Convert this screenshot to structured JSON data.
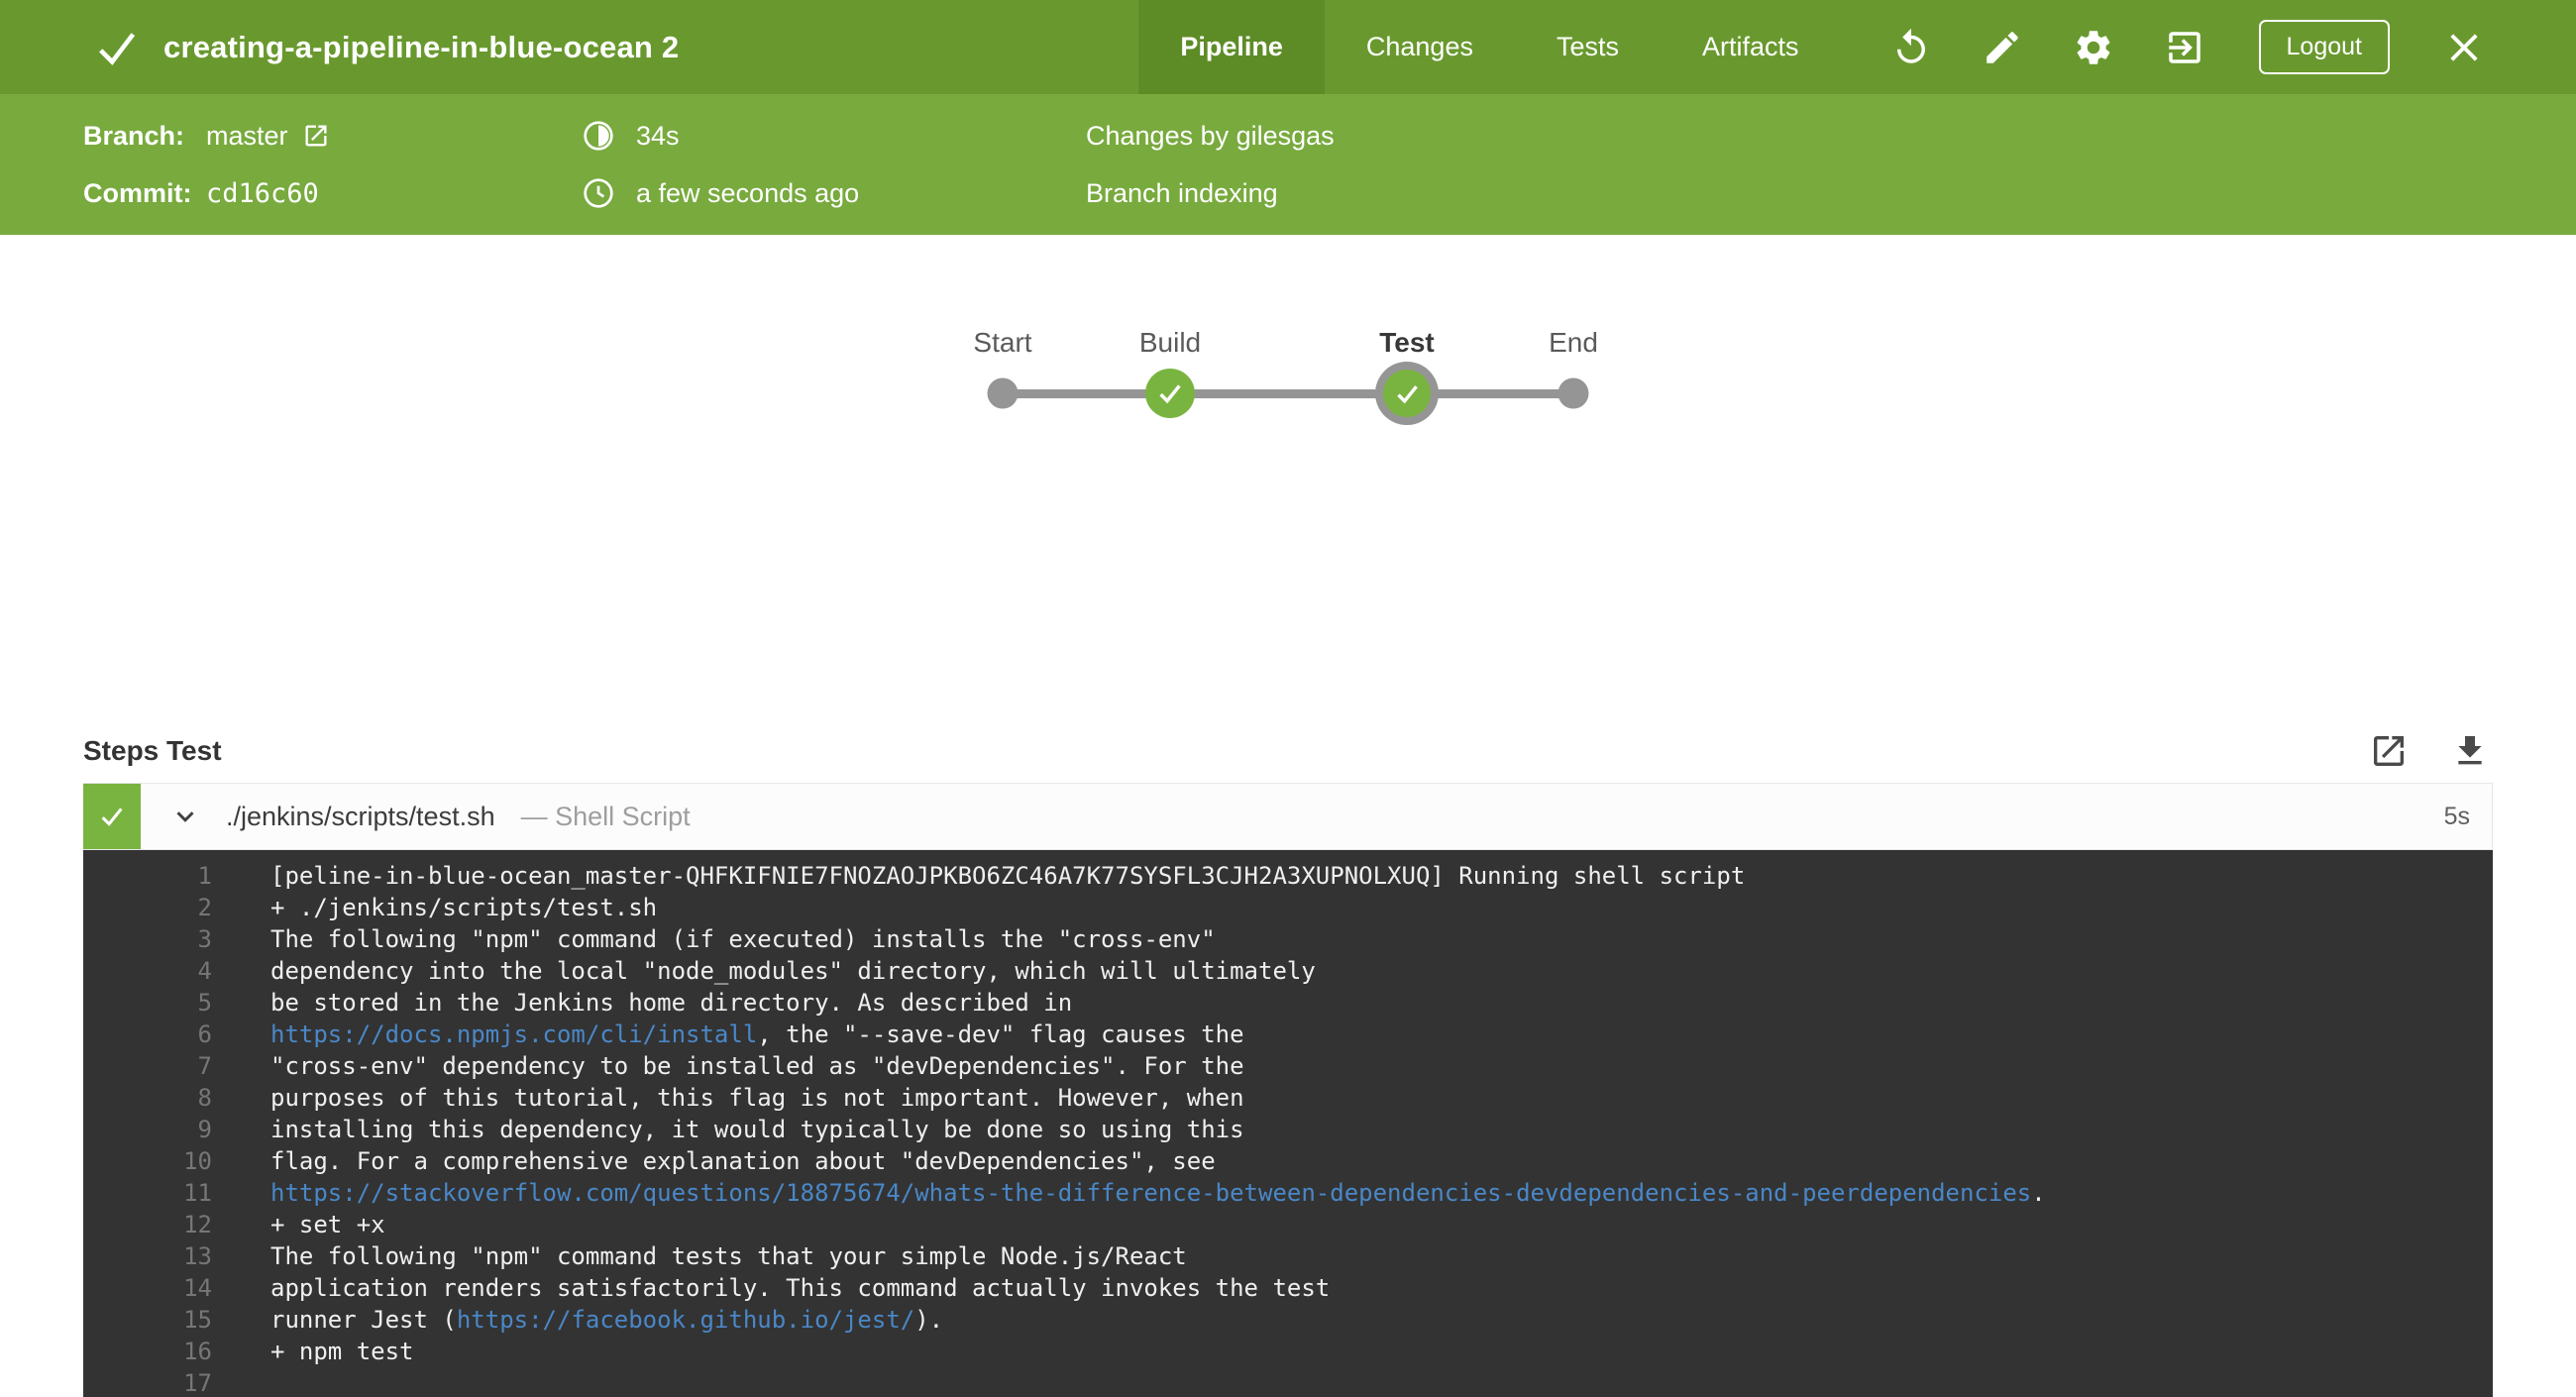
{
  "header": {
    "title": "creating-a-pipeline-in-blue-ocean 2",
    "tabs": [
      {
        "label": "Pipeline",
        "selected": true
      },
      {
        "label": "Changes",
        "selected": false
      },
      {
        "label": "Tests",
        "selected": false
      },
      {
        "label": "Artifacts",
        "selected": false
      }
    ],
    "logout_label": "Logout",
    "icons": [
      "rerun-icon",
      "edit-icon",
      "settings-icon",
      "exit-icon",
      "close-icon"
    ],
    "status": "success"
  },
  "run_info": {
    "branch_label": "Branch:",
    "branch_value": "master",
    "commit_label": "Commit:",
    "commit_value": "cd16c60",
    "duration": "34s",
    "finished": "a few seconds ago",
    "changes": "Changes by gilesgas",
    "cause": "Branch indexing"
  },
  "graph": {
    "nodes": [
      {
        "label": "Start",
        "type": "dot",
        "selected": false
      },
      {
        "label": "Build",
        "type": "success",
        "selected": false
      },
      {
        "label": "Test",
        "type": "success",
        "selected": true
      },
      {
        "label": "End",
        "type": "dot",
        "selected": false
      }
    ]
  },
  "steps": {
    "heading": "Steps Test",
    "step": {
      "name": "./jenkins/scripts/test.sh",
      "kind": "— Shell Script",
      "duration": "5s",
      "status": "success"
    }
  },
  "console": {
    "lines": [
      {
        "n": "1",
        "segments": [
          {
            "text": "[peline-in-blue-ocean_master-QHFKIFNIE7FNOZAOJPKBO6ZC46A7K77SYSFL3CJH2A3XUPNOLXUQ] Running shell script"
          }
        ]
      },
      {
        "n": "2",
        "segments": [
          {
            "text": "+ ./jenkins/scripts/test.sh"
          }
        ]
      },
      {
        "n": "3",
        "segments": [
          {
            "text": "The following \"npm\" command (if executed) installs the \"cross-env\""
          }
        ]
      },
      {
        "n": "4",
        "segments": [
          {
            "text": "dependency into the local \"node_modules\" directory, which will ultimately"
          }
        ]
      },
      {
        "n": "5",
        "segments": [
          {
            "text": "be stored in the Jenkins home directory. As described in"
          }
        ]
      },
      {
        "n": "6",
        "segments": [
          {
            "text": "https://docs.npmjs.com/cli/install",
            "link": true
          },
          {
            "text": ", the \"--save-dev\" flag causes the"
          }
        ]
      },
      {
        "n": "7",
        "segments": [
          {
            "text": "\"cross-env\" dependency to be installed as \"devDependencies\". For the"
          }
        ]
      },
      {
        "n": "8",
        "segments": [
          {
            "text": "purposes of this tutorial, this flag is not important. However, when"
          }
        ]
      },
      {
        "n": "9",
        "segments": [
          {
            "text": "installing this dependency, it would typically be done so using this"
          }
        ]
      },
      {
        "n": "10",
        "segments": [
          {
            "text": "flag. For a comprehensive explanation about \"devDependencies\", see"
          }
        ]
      },
      {
        "n": "11",
        "segments": [
          {
            "text": "https://stackoverflow.com/questions/18875674/whats-the-difference-between-dependencies-devdependencies-and-peerdependencies",
            "link": true
          },
          {
            "text": "."
          }
        ]
      },
      {
        "n": "12",
        "segments": [
          {
            "text": "+ set +x"
          }
        ]
      },
      {
        "n": "13",
        "segments": [
          {
            "text": "The following \"npm\" command tests that your simple Node.js/React"
          }
        ]
      },
      {
        "n": "14",
        "segments": [
          {
            "text": "application renders satisfactorily. This command actually invokes the test"
          }
        ]
      },
      {
        "n": "15",
        "segments": [
          {
            "text": "runner Jest ("
          },
          {
            "text": "https://facebook.github.io/jest/",
            "link": true
          },
          {
            "text": ")."
          }
        ]
      },
      {
        "n": "16",
        "segments": [
          {
            "text": "+ npm test"
          }
        ]
      },
      {
        "n": "17",
        "segments": []
      }
    ]
  },
  "colors": {
    "topbar": "#69992e",
    "tab_selected": "#5d8c27",
    "infobar": "#78aa3e",
    "success_green": "#7ab440",
    "graph_gray": "#959595",
    "console_bg": "#333333",
    "console_link": "#4a87c7"
  }
}
